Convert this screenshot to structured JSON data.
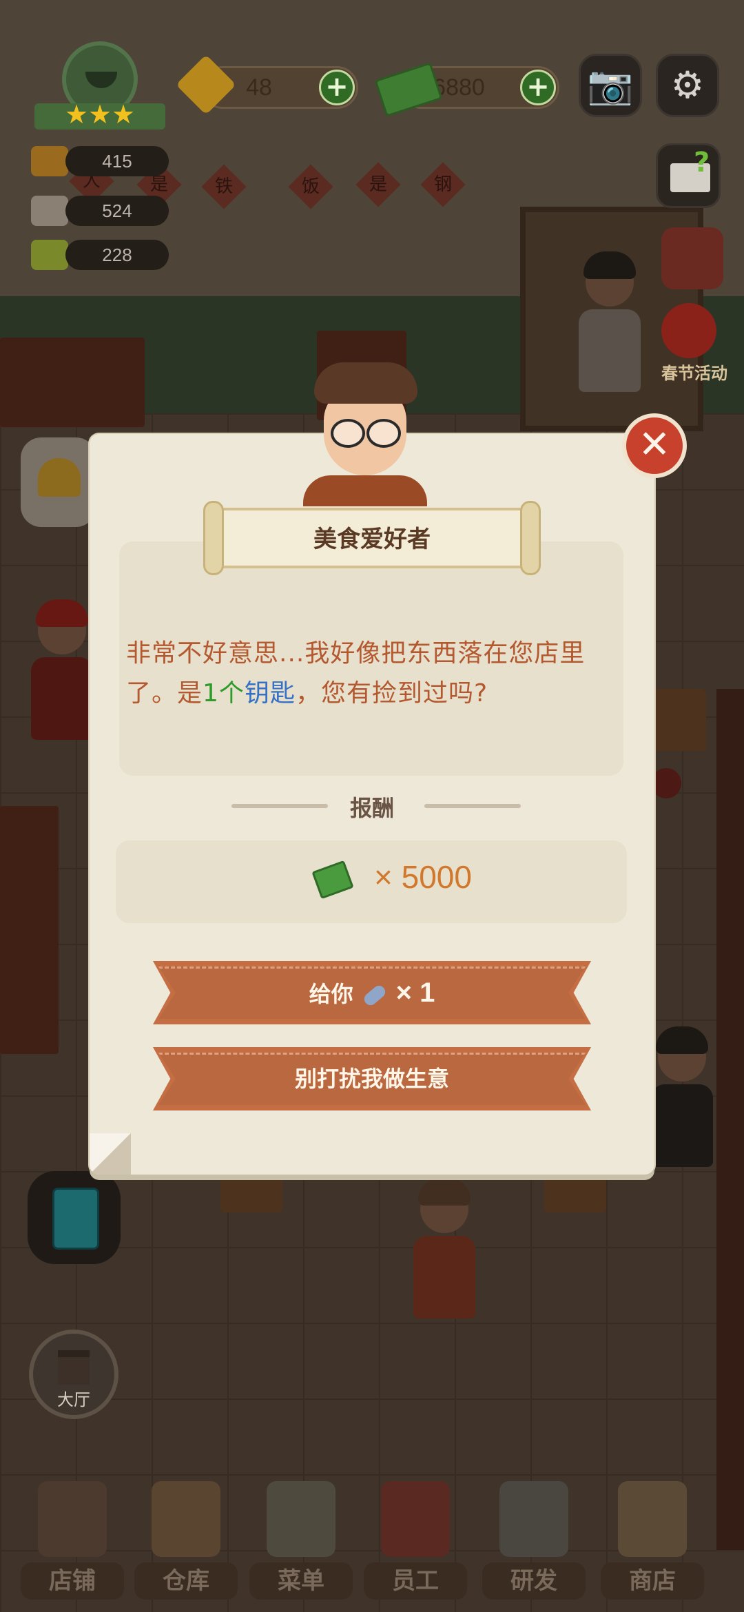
{
  "hud": {
    "gems": "48",
    "cash": "6880",
    "stats": [
      "415",
      "524",
      "228"
    ],
    "event_label": "春节活动",
    "hall_label": "大厅"
  },
  "wall_signs": [
    "人",
    "是",
    "铁",
    "饭",
    "是",
    "钢"
  ],
  "dialog": {
    "title": "美食爱好者",
    "message_part1": "非常不好意思...我好像把东西落在您店里了。是",
    "message_count": "1",
    "message_unit": "个",
    "message_item": "钥匙",
    "message_part2": "，您有捡到过吗?",
    "reward_title": "报酬",
    "reward_amount": "× 5000",
    "give_label": "给你",
    "give_qty": "× 1",
    "decline_label": "别打扰我做生意",
    "close_symbol": "✕"
  },
  "nav": {
    "items": [
      {
        "label": "店铺"
      },
      {
        "label": "仓库"
      },
      {
        "label": "菜单"
      },
      {
        "label": "员工"
      },
      {
        "label": "研发"
      },
      {
        "label": "商店"
      }
    ]
  },
  "icons": {
    "camera": "📷",
    "settings": "⚙",
    "plus": "+",
    "star": "★"
  }
}
